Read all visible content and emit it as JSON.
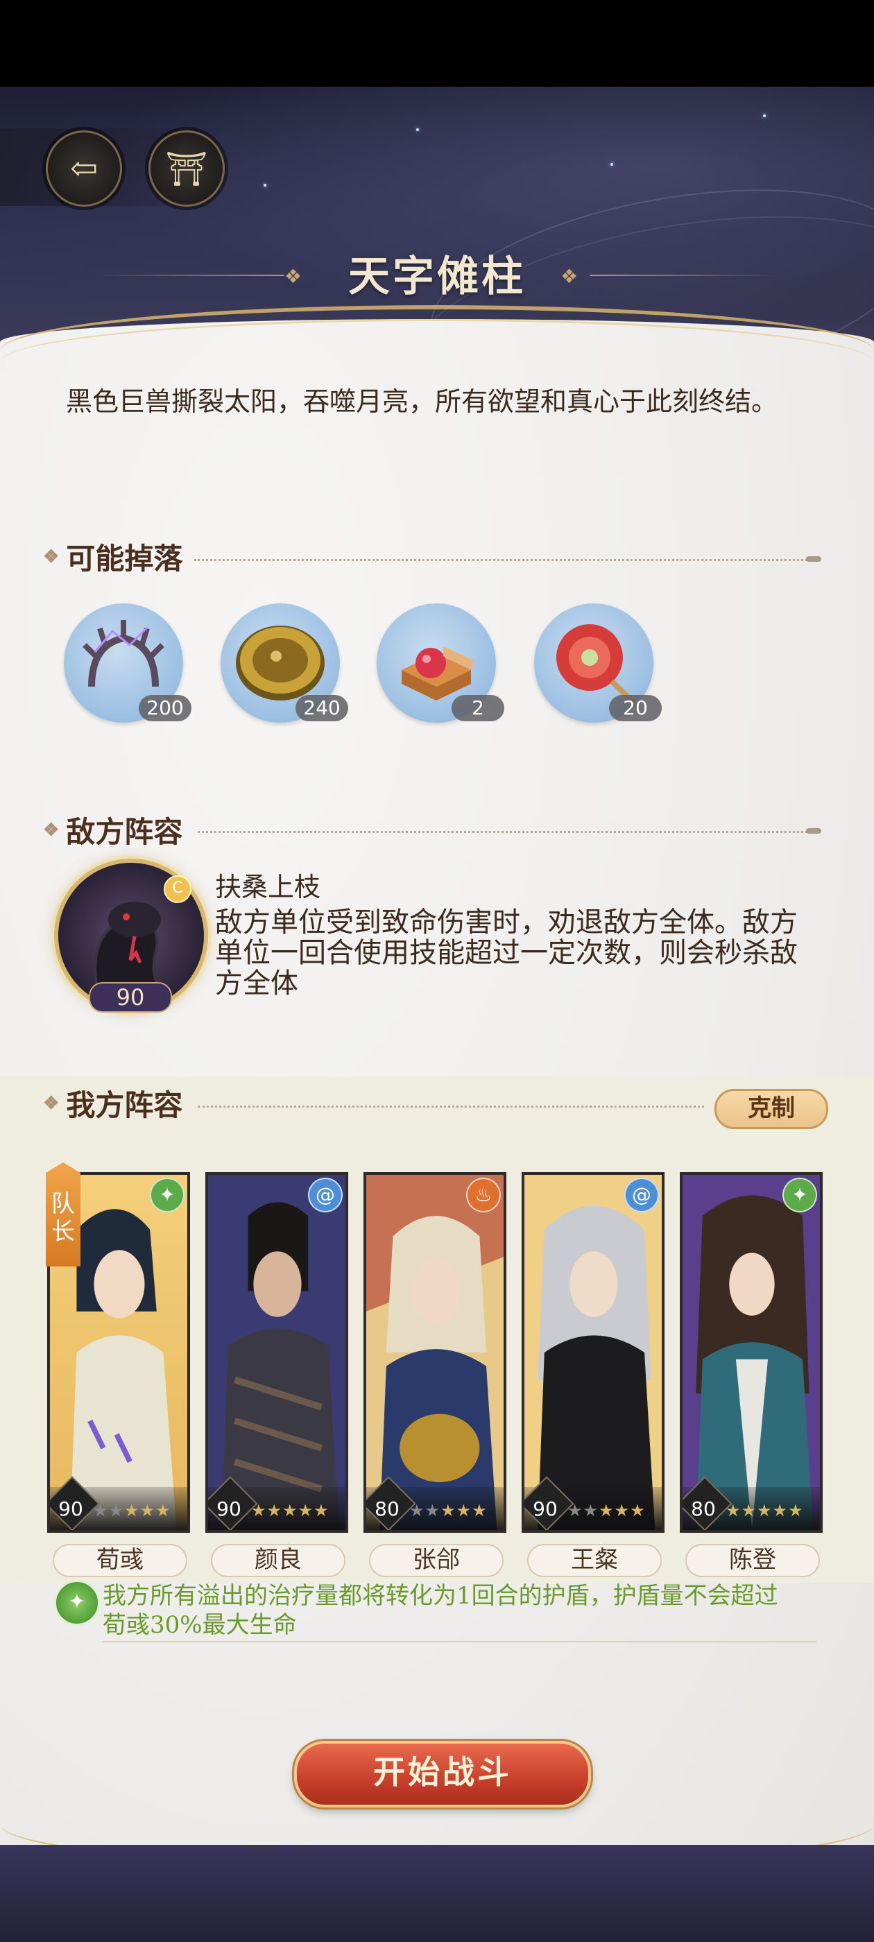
{
  "header": {
    "title": "天字傩柱",
    "back_icon": "back-arrow-icon",
    "pavilion_icon": "pavilion-icon"
  },
  "description": "黑色巨兽撕裂太阳，吞噬月亮，所有欲望和真心于此刻终结。",
  "drops": {
    "heading": "可能掉落",
    "items": [
      {
        "icon": "antler-icon",
        "count": "200"
      },
      {
        "icon": "gold-coin-icon",
        "count": "240"
      },
      {
        "icon": "jewel-box-icon",
        "count": "2"
      },
      {
        "icon": "lotus-fan-icon",
        "count": "20"
      }
    ]
  },
  "enemy": {
    "heading": "敌方阵容",
    "name": "扶桑上枝",
    "level": "90",
    "badge": "C",
    "description": "敌方单位受到致命伤害时，劝退敌方全体。敌方单位一回合使用技能超过一定次数，则会秒杀敌方全体"
  },
  "team": {
    "heading": "我方阵容",
    "counter_label": "克制",
    "leader_label": "队长",
    "heroes": [
      {
        "name": "荀彧",
        "level": "90",
        "element": "leaf-icon",
        "stars": 4
      },
      {
        "name": "颜良",
        "level": "90",
        "element": "wind-swirl-icon",
        "stars": 5
      },
      {
        "name": "张郃",
        "level": "80",
        "element": "fire-icon",
        "stars": 3
      },
      {
        "name": "王粲",
        "level": "90",
        "element": "wind-swirl-icon",
        "stars": 3
      },
      {
        "name": "陈登",
        "level": "80",
        "element": "leaf-icon",
        "stars": 5
      }
    ],
    "skill_text": "我方所有溢出的治疗量都将转化为1回合的护盾，护盾量不会超过荀彧30%最大生命"
  },
  "start_button": "开始战斗",
  "colors": {
    "accent_gold": "#d9b56c",
    "start_red": "#c83f2b",
    "skill_green": "#6a9a2a"
  }
}
